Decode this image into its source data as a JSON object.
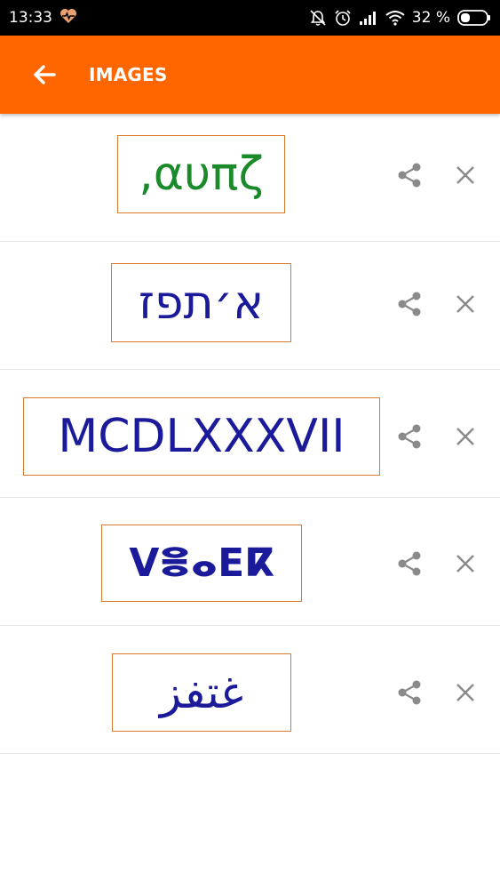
{
  "status_bar": {
    "time": "13:33",
    "battery_percent": "32 %",
    "icons": [
      "heart-pulse-icon",
      "alarm-off-icon",
      "alarm-clock-icon",
      "signal-icon",
      "wifi-icon",
      "battery-icon"
    ]
  },
  "app_bar": {
    "title": "IMAGES",
    "back_icon": "arrow-back-icon",
    "color": "#ff6600"
  },
  "images": [
    {
      "text": ",αυπζ",
      "color": "#1a8a2a"
    },
    {
      "text": "א׳תפז",
      "color": "#1a1a9a"
    },
    {
      "text": "MCDLXXXVII",
      "color": "#1a1a9a"
    },
    {
      "text": "ⴸⴻⴰⴹⴽ",
      "color": "#1a1a9a"
    },
    {
      "text": "غتفز",
      "color": "#1a1a9a"
    }
  ],
  "row_actions": {
    "share_icon": "share-icon",
    "close_icon": "close-icon"
  }
}
